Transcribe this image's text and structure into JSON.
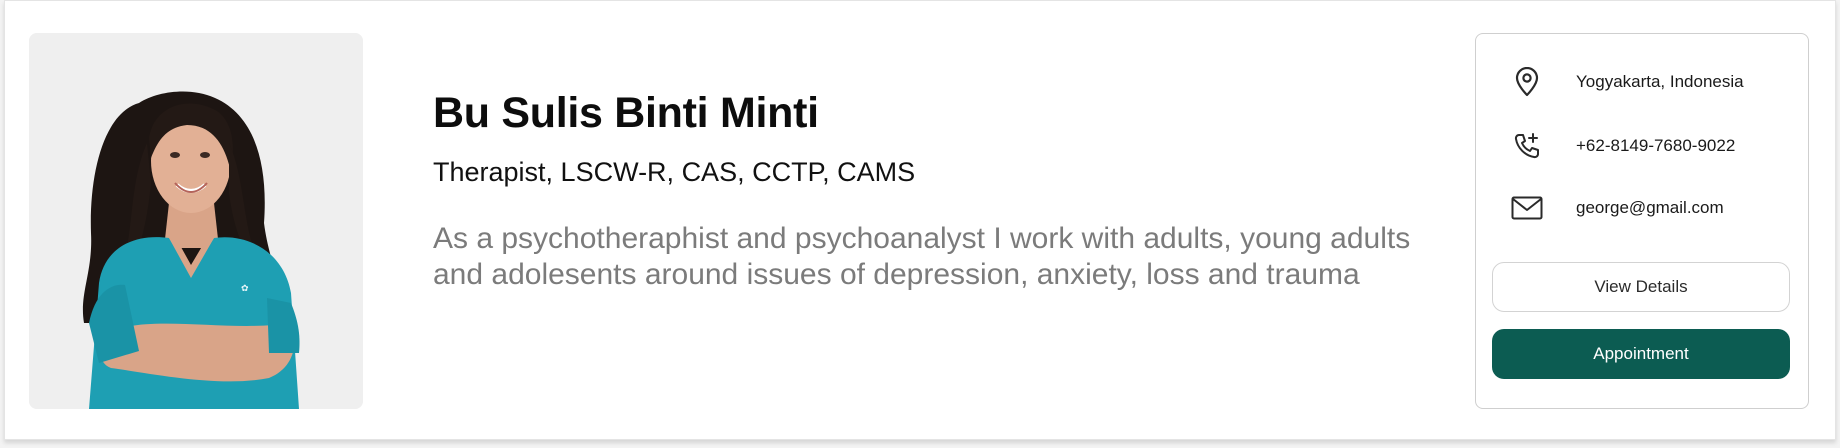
{
  "profile": {
    "name": "Bu Sulis Binti Minti",
    "credentials": "Therapist, LSCW-R, CAS, CCTP, CAMS",
    "bio": "As a psychotheraphist and psychoanalyst I work with adults, young adults and adolesents around issues of depression, anxiety, loss and trauma"
  },
  "contact": {
    "location": "Yogyakarta, Indonesia",
    "phone": "+62-8149-7680-9022",
    "email": "george@gmail.com",
    "icons": [
      "location-pin-icon",
      "phone-plus-icon",
      "mail-icon"
    ]
  },
  "actions": {
    "view_details_label": "View Details",
    "appointment_label": "Appointment"
  },
  "colors": {
    "accent": "#0c5c52",
    "bio_text": "#7b7b7b",
    "scrub_teal": "#1e9fb3"
  }
}
